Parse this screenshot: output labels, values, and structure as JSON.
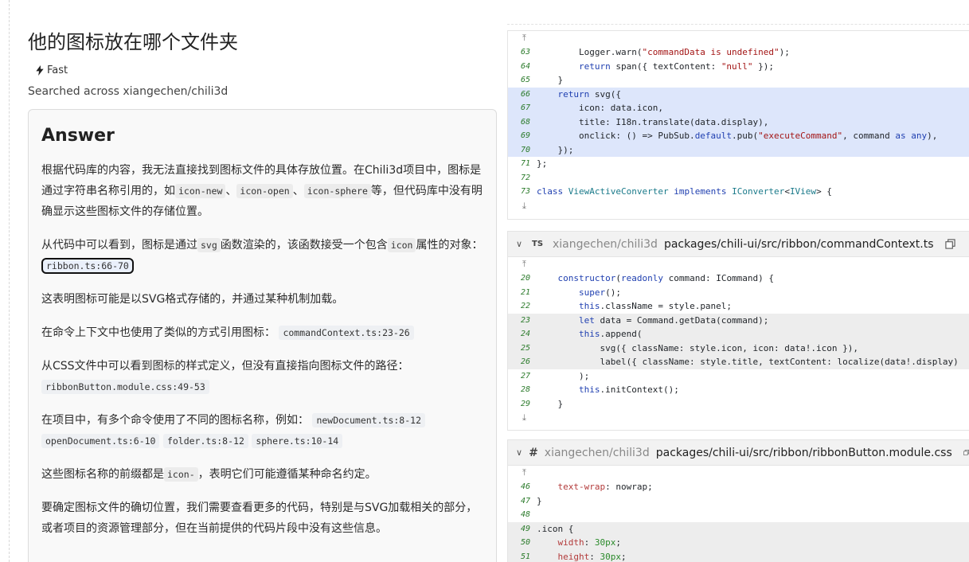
{
  "question": {
    "title": "他的图标放在哪个文件夹",
    "mode_label": "Fast",
    "searched_label": "Searched across xiangechen/chili3d"
  },
  "answer": {
    "heading": "Answer",
    "p1_a": "根据代码库的内容，我无法直接找到图标文件的具体存放位置。在Chili3d项目中，图标是通过字符串名称引用的，如",
    "p1_code1": "icon-new",
    "p1_sep1": "、",
    "p1_code2": "icon-open",
    "p1_sep2": "、",
    "p1_code3": "icon-sphere",
    "p1_b": "等，但代码库中没有明确显示这些图标文件的存储位置。",
    "p2_a": "从代码中可以看到，图标是通过",
    "p2_code1": "svg",
    "p2_b": "函数渲染的，该函数接受一个包含",
    "p2_code2": "icon",
    "p2_c": "属性的对象：",
    "p2_ref": "ribbon.ts:66-70",
    "p3": "这表明图标可能是以SVG格式存储的，并通过某种机制加载。",
    "p4_a": "在命令上下文中也使用了类似的方式引用图标：",
    "p4_ref": "commandContext.ts:23-26",
    "p5_a": "从CSS文件中可以看到图标的样式定义，但没有直接指向图标文件的路径：",
    "p5_ref": "ribbonButton.module.css:49-53",
    "p6_a": "在项目中，有多个命令使用了不同的图标名称，例如：",
    "p6_ref1": "newDocument.ts:8-12",
    "p6_ref2": "openDocument.ts:6-10",
    "p6_ref3": "folder.ts:8-12",
    "p6_ref4": "sphere.ts:10-14",
    "p7_a": "这些图标名称的前缀都是",
    "p7_code": "icon-",
    "p7_b": "，表明它们可能遵循某种命名约定。",
    "p8": "要确定图标文件的确切位置，我们需要查看更多的代码，特别是与SVG加载相关的部分，或者项目的资源管理部分，但在当前提供的代码片段中没有这些信息。"
  },
  "panels": [
    {
      "file_type": "",
      "repo": "",
      "path": "",
      "lines": [
        {
          "n": "63",
          "hl": "",
          "t": "        Logger.warn(\"commandData is undefined\");"
        },
        {
          "n": "64",
          "hl": "",
          "t": "        return span({ textContent: \"null\" });"
        },
        {
          "n": "65",
          "hl": "",
          "t": "    }"
        },
        {
          "n": "66",
          "hl": "blue",
          "t": "    return svg({"
        },
        {
          "n": "67",
          "hl": "blue",
          "t": "        icon: data.icon,"
        },
        {
          "n": "68",
          "hl": "blue",
          "t": "        title: I18n.translate(data.display),"
        },
        {
          "n": "69",
          "hl": "blue",
          "t": "        onclick: () => PubSub.default.pub(\"executeCommand\", command as any),"
        },
        {
          "n": "70",
          "hl": "blue",
          "t": "    });"
        },
        {
          "n": "71",
          "hl": "",
          "t": "};"
        },
        {
          "n": "72",
          "hl": "",
          "t": ""
        },
        {
          "n": "73",
          "hl": "",
          "t": "class ViewActiveConverter implements IConverter<IView> {"
        }
      ]
    },
    {
      "file_type": "TS",
      "repo": "xiangechen/chili3d",
      "path": "packages/chili-ui/src/ribbon/commandContext.ts",
      "lines": [
        {
          "n": "20",
          "hl": "",
          "t": "    constructor(readonly command: ICommand) {"
        },
        {
          "n": "21",
          "hl": "",
          "t": "        super();"
        },
        {
          "n": "22",
          "hl": "",
          "t": "        this.className = style.panel;"
        },
        {
          "n": "23",
          "hl": "gray",
          "t": "        let data = Command.getData(command);"
        },
        {
          "n": "24",
          "hl": "gray",
          "t": "        this.append("
        },
        {
          "n": "25",
          "hl": "gray",
          "t": "            svg({ className: style.icon, icon: data!.icon }),"
        },
        {
          "n": "26",
          "hl": "gray",
          "t": "            label({ className: style.title, textContent: localize(data!.display)"
        },
        {
          "n": "27",
          "hl": "",
          "t": "        );"
        },
        {
          "n": "28",
          "hl": "",
          "t": "        this.initContext();"
        },
        {
          "n": "29",
          "hl": "",
          "t": "    }"
        }
      ]
    },
    {
      "file_type": "#",
      "repo": "xiangechen/chili3d",
      "path": "packages/chili-ui/src/ribbon/ribbonButton.module.css",
      "lines": [
        {
          "n": "46",
          "hl": "",
          "t": "    text-wrap: nowrap;"
        },
        {
          "n": "47",
          "hl": "",
          "t": "}"
        },
        {
          "n": "48",
          "hl": "",
          "t": ""
        },
        {
          "n": "49",
          "hl": "gray",
          "t": ".icon {"
        },
        {
          "n": "50",
          "hl": "gray",
          "t": "    width: 30px;"
        },
        {
          "n": "51",
          "hl": "gray",
          "t": "    height: 30px;"
        }
      ]
    }
  ]
}
